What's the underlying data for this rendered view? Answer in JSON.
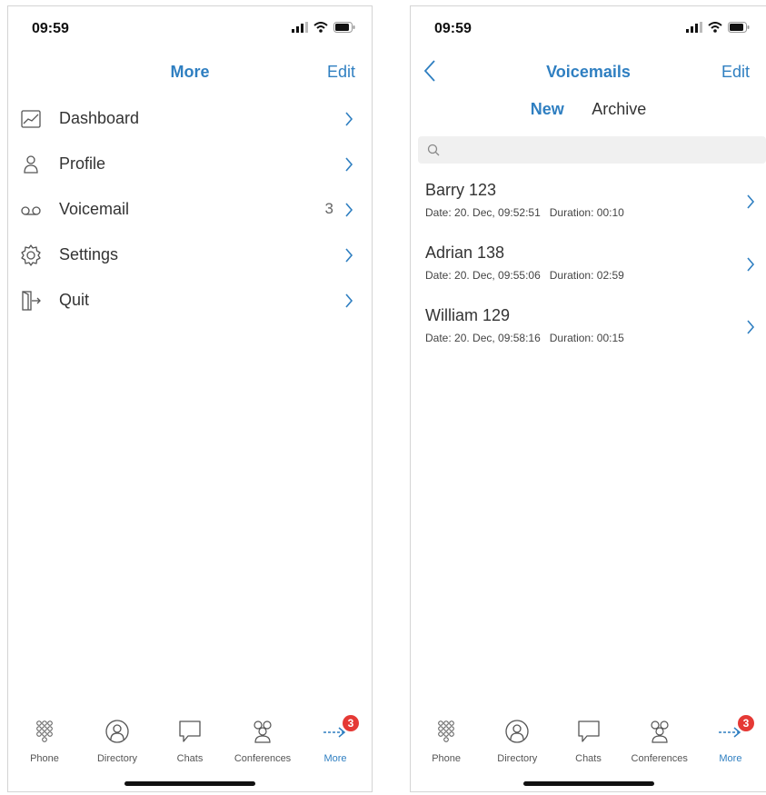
{
  "left": {
    "status_time": "09:59",
    "title": "More",
    "edit_label": "Edit",
    "menu": [
      {
        "label": "Dashboard",
        "icon": "chart-icon",
        "count": ""
      },
      {
        "label": "Profile",
        "icon": "user-icon",
        "count": ""
      },
      {
        "label": "Voicemail",
        "icon": "voicemail-icon",
        "count": "3"
      },
      {
        "label": "Settings",
        "icon": "gear-icon",
        "count": ""
      },
      {
        "label": "Quit",
        "icon": "exit-icon",
        "count": ""
      }
    ]
  },
  "right": {
    "status_time": "09:59",
    "title": "Voicemails",
    "edit_label": "Edit",
    "tabs": [
      {
        "label": "New",
        "active": true
      },
      {
        "label": "Archive",
        "active": false
      }
    ],
    "search_placeholder": "",
    "voicemails": [
      {
        "name": "Barry 123",
        "date": "Date: 20. Dec, 09:52:51",
        "duration": "Duration: 00:10"
      },
      {
        "name": "Adrian 138",
        "date": "Date: 20. Dec, 09:55:06",
        "duration": "Duration: 02:59"
      },
      {
        "name": "William 129",
        "date": "Date: 20. Dec, 09:58:16",
        "duration": "Duration: 00:15"
      }
    ]
  },
  "tab_bar": {
    "items": [
      {
        "label": "Phone",
        "icon": "keypad-icon"
      },
      {
        "label": "Directory",
        "icon": "contact-icon"
      },
      {
        "label": "Chats",
        "icon": "chat-icon"
      },
      {
        "label": "Conferences",
        "icon": "group-icon"
      },
      {
        "label": "More",
        "icon": "more-arrow-icon",
        "active": true,
        "badge": "3"
      }
    ]
  },
  "colors": {
    "accent": "#2f7fc1",
    "badge": "#e53935",
    "text": "#333333"
  }
}
